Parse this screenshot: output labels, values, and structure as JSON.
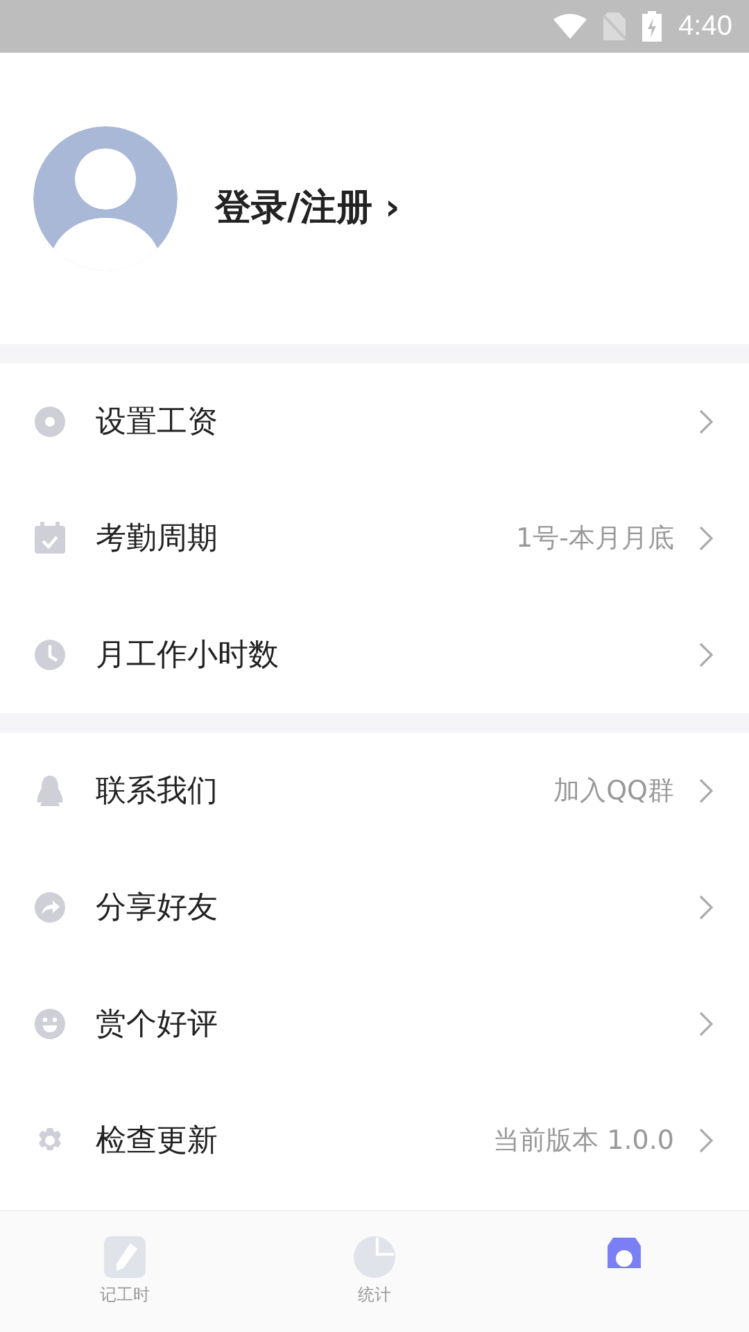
{
  "status_bar": {
    "time": "4:40"
  },
  "profile": {
    "login": "登录/注册 ›"
  },
  "groups": [
    {
      "items": [
        {
          "label": "设置工资"
        },
        {
          "label": "考勤周期",
          "value": "1号-本月月底"
        },
        {
          "label": "月工作小时数"
        }
      ]
    },
    {
      "items": [
        {
          "label": "联系我们",
          "value": "加入QQ群"
        },
        {
          "label": "分享好友"
        },
        {
          "label": "赏个好评"
        },
        {
          "label": "检查更新",
          "value": "当前版本 1.0.0"
        }
      ]
    }
  ],
  "tabs": [
    {
      "label": "记工时",
      "selected": false
    },
    {
      "label": "统计",
      "selected": false
    },
    {
      "selected": true
    }
  ]
}
